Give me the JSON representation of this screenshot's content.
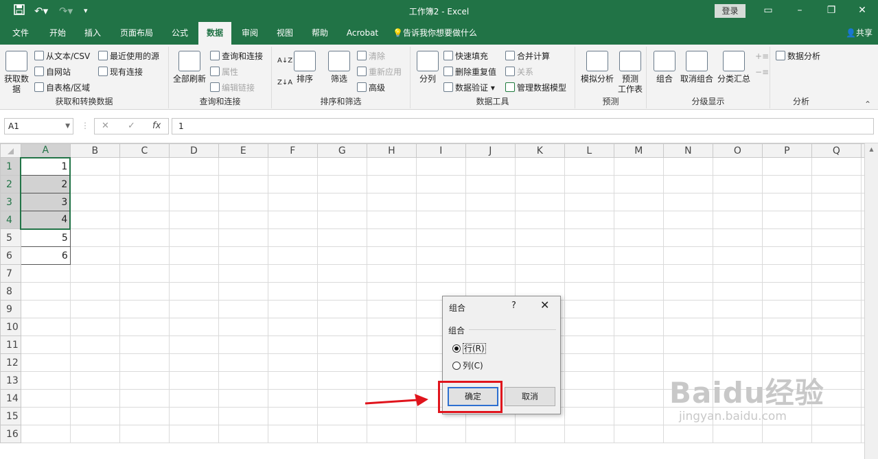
{
  "window": {
    "title": "工作簿2  -  Excel",
    "login": "登录",
    "share": "共享"
  },
  "qat": {
    "save_icon": "save-icon",
    "undo_icon": "undo-icon",
    "redo_icon": "redo-icon",
    "customize_icon": "chevron-down-icon"
  },
  "tabs": [
    {
      "label": "文件"
    },
    {
      "label": "开始"
    },
    {
      "label": "插入"
    },
    {
      "label": "页面布局"
    },
    {
      "label": "公式"
    },
    {
      "label": "数据"
    },
    {
      "label": "审阅"
    },
    {
      "label": "视图"
    },
    {
      "label": "帮助"
    },
    {
      "label": "Acrobat"
    },
    {
      "label": "告诉我你想要做什么"
    }
  ],
  "ribbon": {
    "get": {
      "big": "获取数\n据",
      "b1": "从文本/CSV",
      "b2": "自网站",
      "b3": "自表格/区域",
      "b4": "最近使用的源",
      "b5": "现有连接",
      "label": "获取和转换数据"
    },
    "query": {
      "big": "全部刷新",
      "b1": "查询和连接",
      "b2": "属性",
      "b3": "编辑链接",
      "label": "查询和连接"
    },
    "sort": {
      "az": "A↓Z",
      "za": "Z↓A",
      "big": "排序",
      "filter": "筛选",
      "b1": "清除",
      "b2": "重新应用",
      "b3": "高级",
      "label": "排序和筛选"
    },
    "tools": {
      "big": "分列",
      "b1": "快速填充",
      "b2": "删除重复值",
      "b3": "数据验证",
      "b4": "合并计算",
      "b5": "关系",
      "b6": "管理数据模型",
      "label": "数据工具"
    },
    "forecast": {
      "b1": "模拟分析",
      "b2": "预测\n工作表",
      "label": "预测"
    },
    "outline": {
      "b1": "组合",
      "b2": "取消组合",
      "b3": "分类汇总",
      "label": "分级显示"
    },
    "analysis": {
      "b1": "数据分析",
      "label": "分析"
    }
  },
  "formula_bar": {
    "name_box": "A1",
    "fx": "fx",
    "value": "1"
  },
  "sheet": {
    "columns": [
      "A",
      "B",
      "C",
      "D",
      "E",
      "F",
      "G",
      "H",
      "I",
      "J",
      "K",
      "L",
      "M",
      "N",
      "O",
      "P",
      "Q"
    ],
    "rows": [
      "1",
      "2",
      "3",
      "4",
      "5",
      "6",
      "7",
      "8",
      "9",
      "10",
      "11",
      "12",
      "13",
      "14",
      "15",
      "16"
    ],
    "a_values": [
      "1",
      "2",
      "3",
      "4",
      "5",
      "6"
    ]
  },
  "dialog": {
    "title": "组合",
    "help": "?",
    "close": "✕",
    "section": "组合",
    "opt_row": "行(R)",
    "opt_col": "列(C)",
    "ok": "确定",
    "cancel": "取消",
    "selected": "行(R)"
  },
  "watermark": {
    "text": "Baidu经验",
    "url": "jingyan.baidu.com"
  },
  "colors": {
    "excel_green": "#217346",
    "highlight_red": "#e0141c",
    "selection_gray": "#d2d2d2"
  }
}
